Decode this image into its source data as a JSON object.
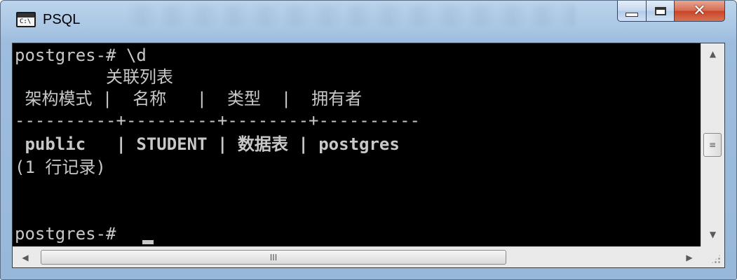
{
  "window": {
    "title": "PSQL",
    "icon": "console-icon",
    "buttons": {
      "minimize": "minimize-icon",
      "maximize": "maximize-icon",
      "close": "✕"
    }
  },
  "console": {
    "lines": [
      "postgres-# \\d",
      "         关联列表",
      " 架构模式 |  名称   |  类型  |  拥有者",
      "----------+---------+--------+----------",
      " public   | STUDENT | 数据表 | postgres",
      "(1 行记录)",
      "",
      "",
      "postgres-# "
    ]
  },
  "scrollbars": {
    "vertical": {
      "up": "▲",
      "down": "▼",
      "thumb": "≡"
    },
    "horizontal": {
      "left": "◀",
      "right": "▶",
      "thumb": "III"
    }
  }
}
